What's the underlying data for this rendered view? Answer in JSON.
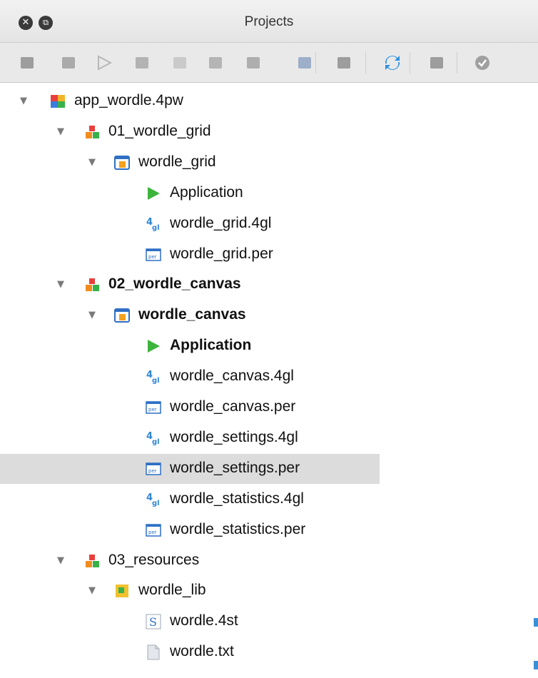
{
  "window": {
    "title": "Projects",
    "close_glyph": "✕",
    "float_glyph": "⧉"
  },
  "toolbar": {
    "buttons": [
      "build-icon",
      "new-package-icon",
      "run-icon",
      "compile-icon",
      "new-folder-icon",
      "add-file-icon",
      "package-icon",
      "new-file-icon",
      "database-icon",
      "sync-icon",
      "deploy-icon",
      "check-icon"
    ]
  },
  "tree": {
    "rows": [
      {
        "label": "app_wordle.4pw",
        "icon": "workspace-icon",
        "level": 0,
        "expanded": true,
        "bold": false,
        "selected": false
      },
      {
        "label": "01_wordle_grid",
        "icon": "group-icon",
        "level": 1,
        "expanded": true,
        "bold": false,
        "selected": false
      },
      {
        "label": "wordle_grid",
        "icon": "application-node-icon",
        "level": 2,
        "expanded": true,
        "bold": false,
        "selected": false
      },
      {
        "label": "Application",
        "icon": "run-target-icon",
        "level": 3,
        "bold": false,
        "selected": false
      },
      {
        "label": "wordle_grid.4gl",
        "icon": "4gl-file-icon",
        "level": 3,
        "bold": false,
        "selected": false
      },
      {
        "label": "wordle_grid.per",
        "icon": "per-file-icon",
        "level": 3,
        "bold": false,
        "selected": false
      },
      {
        "label": "02_wordle_canvas",
        "icon": "group-icon",
        "level": 1,
        "expanded": true,
        "bold": true,
        "selected": false
      },
      {
        "label": "wordle_canvas",
        "icon": "application-node-icon",
        "level": 2,
        "expanded": true,
        "bold": true,
        "selected": false
      },
      {
        "label": "Application",
        "icon": "run-target-icon",
        "level": 3,
        "bold": true,
        "selected": false
      },
      {
        "label": "wordle_canvas.4gl",
        "icon": "4gl-file-icon",
        "level": 3,
        "bold": false,
        "selected": false
      },
      {
        "label": "wordle_canvas.per",
        "icon": "per-file-icon",
        "level": 3,
        "bold": false,
        "selected": false
      },
      {
        "label": "wordle_settings.4gl",
        "icon": "4gl-file-icon",
        "level": 3,
        "bold": false,
        "selected": false
      },
      {
        "label": "wordle_settings.per",
        "icon": "per-file-icon",
        "level": 3,
        "bold": false,
        "selected": true
      },
      {
        "label": "wordle_statistics.4gl",
        "icon": "4gl-file-icon",
        "level": 3,
        "bold": false,
        "selected": false
      },
      {
        "label": "wordle_statistics.per",
        "icon": "per-file-icon",
        "level": 3,
        "bold": false,
        "selected": false
      },
      {
        "label": "03_resources",
        "icon": "group-icon",
        "level": 1,
        "expanded": true,
        "bold": false,
        "selected": false
      },
      {
        "label": "wordle_lib",
        "icon": "library-icon",
        "level": 2,
        "expanded": true,
        "bold": false,
        "selected": false
      },
      {
        "label": "wordle.4st",
        "icon": "style-file-icon",
        "level": 3,
        "bold": false,
        "selected": false
      },
      {
        "label": "wordle.txt",
        "icon": "text-file-icon",
        "level": 3,
        "bold": false,
        "selected": false
      }
    ]
  },
  "icon_text": {
    "4gl": "4gl",
    "per": "per",
    "s": "S"
  },
  "colors": {
    "selection": "#dcdcdc",
    "run_green": "#3cb43c",
    "per_blue": "#2f6fc4",
    "group_orange": "#f08c1e"
  }
}
